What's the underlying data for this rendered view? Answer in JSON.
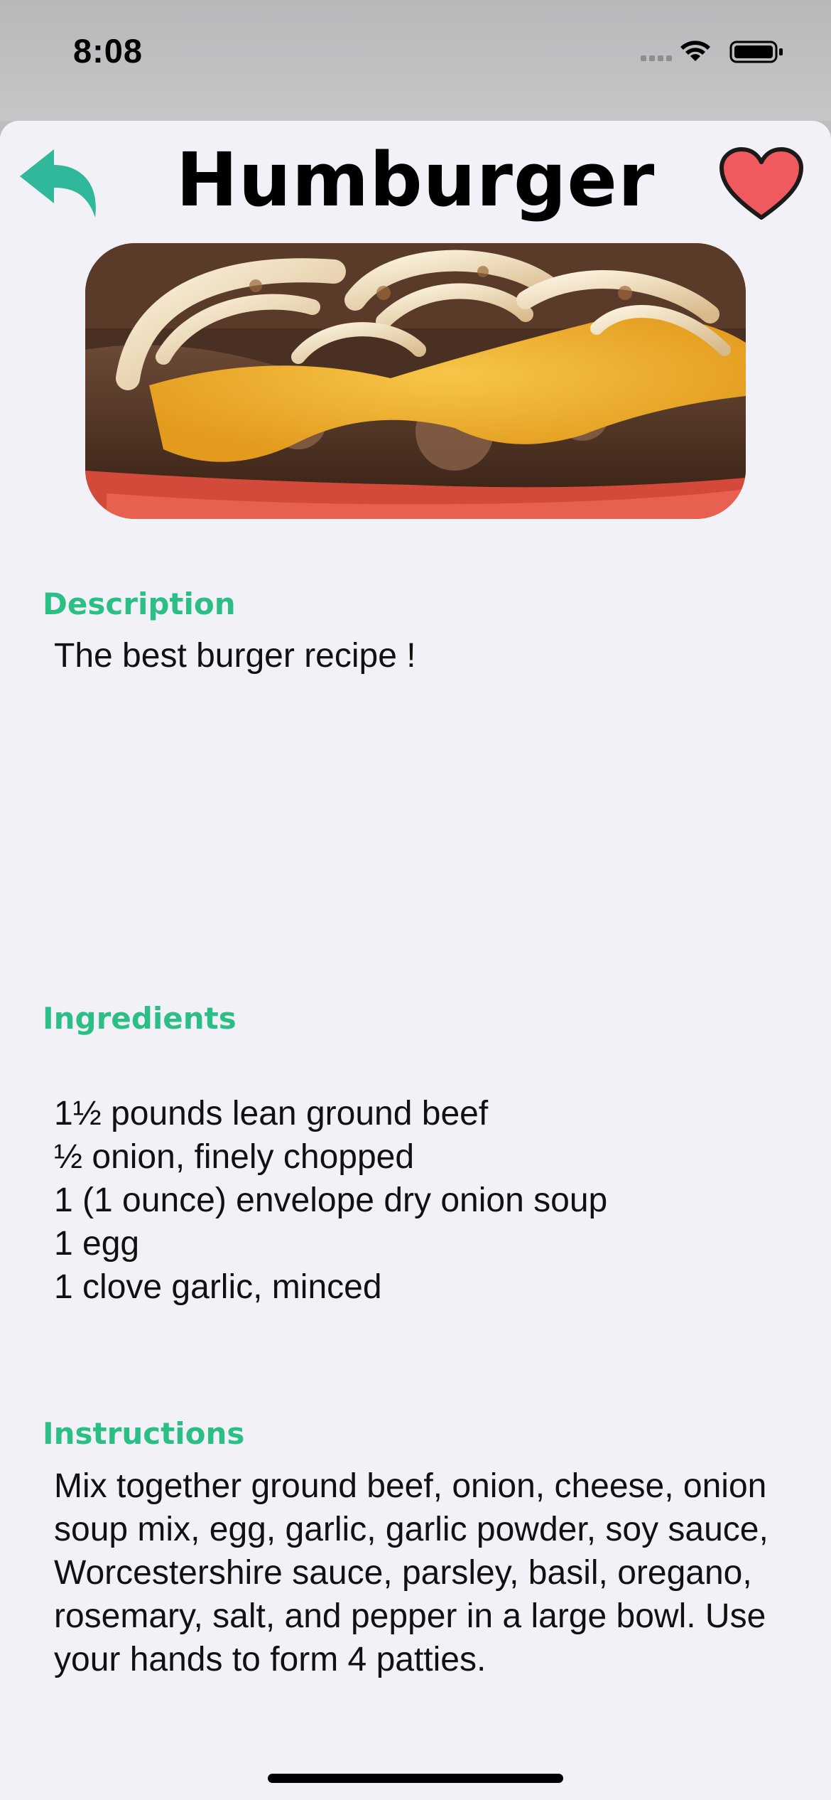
{
  "status_bar": {
    "time": "8:08"
  },
  "header": {
    "title": "Humburger",
    "back_icon": "reply-arrow-icon",
    "favorite_icon": "heart-icon"
  },
  "colors": {
    "accent_green": "#2bbf85",
    "heart_red": "#f05a5e",
    "back_teal": "#2fb89a",
    "sheet_background": "#f2f1f7"
  },
  "hero_image": {
    "subject": "burger with melted cheese and grilled onions"
  },
  "description": {
    "heading": "Description",
    "text": "The best burger recipe !"
  },
  "ingredients": {
    "heading": "Ingredients",
    "items": [
      "1½ pounds lean ground beef",
      "½ onion, finely chopped",
      "1 (1 ounce) envelope dry onion soup",
      "1 egg",
      "1 clove garlic, minced"
    ]
  },
  "instructions": {
    "heading": "Instructions",
    "text": "Mix together ground beef, onion, cheese, onion soup mix, egg, garlic, garlic powder, soy sauce, Worcestershire sauce, parsley, basil, oregano, rosemary, salt, and pepper in a large bowl. Use your hands to form 4 patties."
  }
}
